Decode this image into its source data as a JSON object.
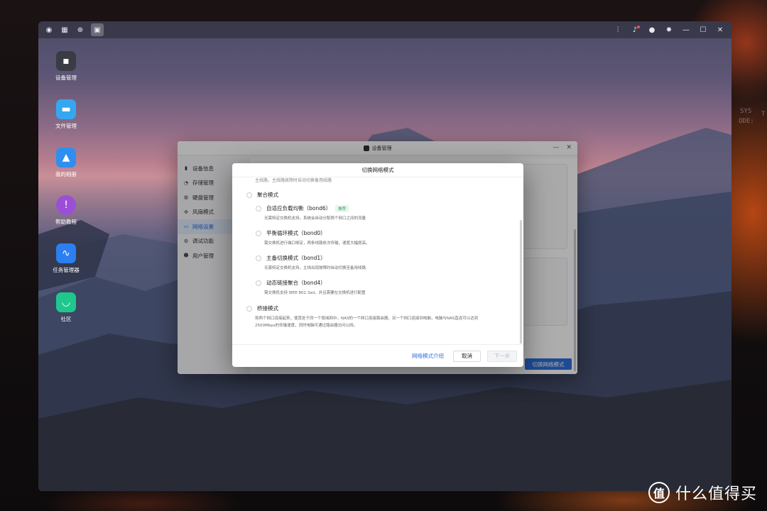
{
  "backdrop": {
    "deco_sys": "SYS",
    "deco_t": "T",
    "deco_ode": "ODE:"
  },
  "sysbar": {
    "left_icons": [
      "camera-icon",
      "apps-grid-icon",
      "globe-icon",
      "window-icon"
    ],
    "right_icons": [
      "equalizer-icon",
      "bell-icon",
      "user-icon",
      "gear-icon",
      "minimize-icon",
      "maximize-icon",
      "close-icon"
    ]
  },
  "desktop": {
    "icons": [
      {
        "label": "设备管理",
        "icon": "device-icon",
        "color": "#3a3c44"
      },
      {
        "label": "文件管理",
        "icon": "folder-icon",
        "color": "#35a7f0"
      },
      {
        "label": "我的相册",
        "icon": "photo-icon",
        "color": "#2f8ff0"
      },
      {
        "label": "帮助教程",
        "icon": "help-icon",
        "color": "#9b4fd6"
      },
      {
        "label": "任务管理器",
        "icon": "monitor-icon",
        "color": "#2b7ff0"
      },
      {
        "label": "社区",
        "icon": "chat-icon",
        "color": "#1fc78c"
      }
    ]
  },
  "app": {
    "title": "设备管理",
    "sidebar": [
      {
        "label": "设备信息",
        "icon": "info-icon"
      },
      {
        "label": "存储管理",
        "icon": "storage-icon"
      },
      {
        "label": "硬盘管理",
        "icon": "disk-icon"
      },
      {
        "label": "风扇模式",
        "icon": "fan-icon"
      },
      {
        "label": "网络设置",
        "icon": "network-icon",
        "selected": true
      },
      {
        "label": "调试功能",
        "icon": "debug-icon"
      },
      {
        "label": "用户管理",
        "icon": "users-icon"
      }
    ],
    "action_button": "切换网络模式"
  },
  "modal": {
    "title": "切换网络模式",
    "cut_text": "主线路，主线路故障时自动切换备用线路",
    "aggregate": {
      "label": "聚合模式",
      "options": [
        {
          "label": "自适应负载均衡（bond6）",
          "badge": "推荐",
          "desc": "无需特定交换机支持，系统会自动分配两个网口之间的流量"
        },
        {
          "label": "平衡循环模式（bond0）",
          "desc": "需交换机进行端口绑定，两条线路依次传输，速度大幅提高。"
        },
        {
          "label": "主备切换模式（bond1）",
          "desc": "无需特定交换机支持，主线出现故障时自动切换至备用线路"
        },
        {
          "label": "动态链接聚合（bond4）",
          "desc": "需交换机支持 IEEE 802.3ad，并且需要在交换机进行配置"
        }
      ]
    },
    "bridge": {
      "label": "桥接模式",
      "desc1": "将两个网口连接起来，使其处于同一个局域网中。NAS的一个网口连接路由器，另一个网口连接到电脑，电脑与NAS直连可以达到",
      "desc2": "2500Mbps的传输速度，同时电脑可通过路由器访问公网。"
    },
    "footer": {
      "link": "网络模式介绍",
      "cancel": "取消",
      "next": "下一步"
    }
  },
  "watermark": {
    "logo": "值",
    "text": "什么值得买"
  }
}
